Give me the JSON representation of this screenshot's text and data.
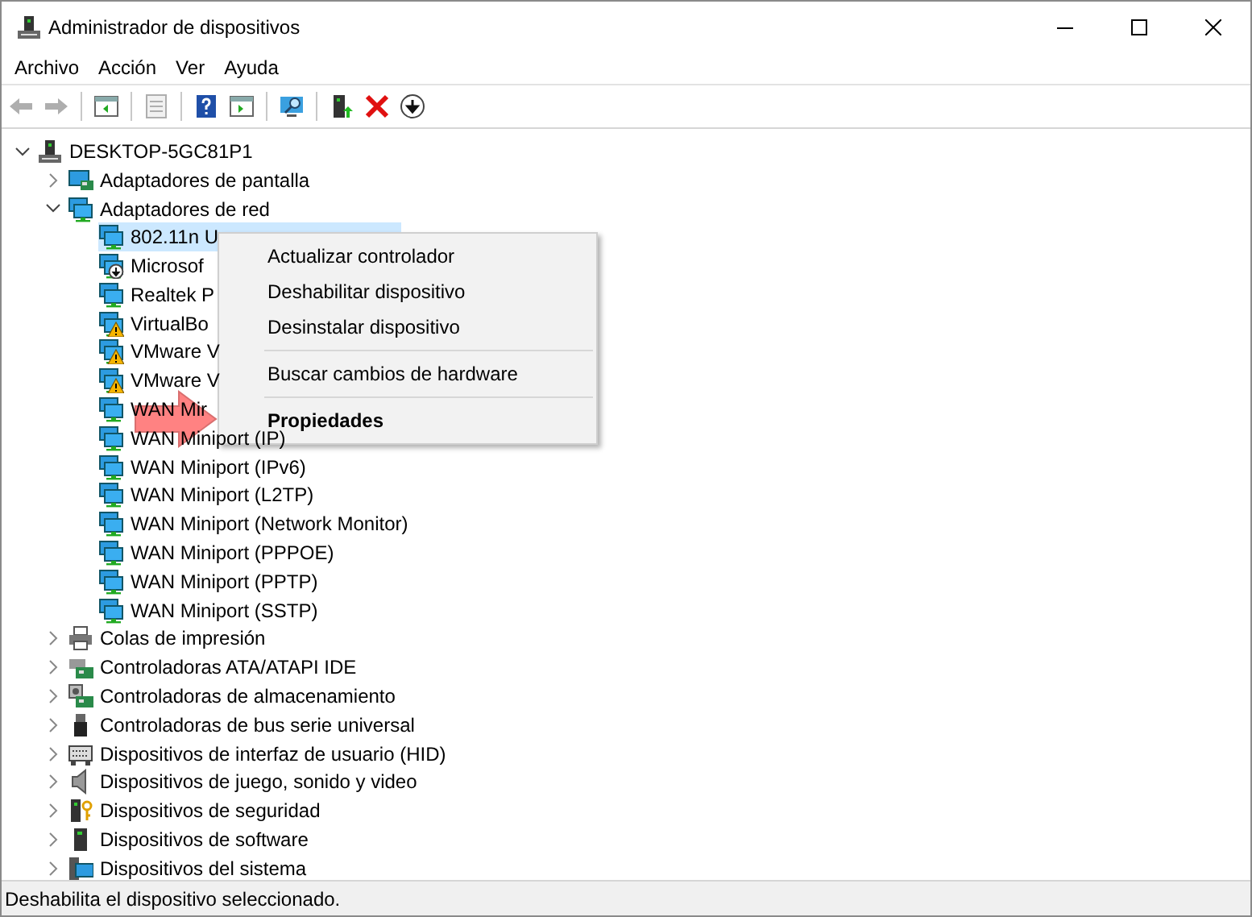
{
  "window": {
    "title": "Administrador de dispositivos"
  },
  "menu_bar": [
    "Archivo",
    "Acción",
    "Ver",
    "Ayuda"
  ],
  "toolbar": [
    {
      "disabled": true
    },
    {
      "disabled": true
    },
    {
      "disabled": false
    },
    {
      "disabled": true
    },
    {
      "disabled": false
    },
    {
      "disabled": false
    },
    {
      "disabled": false
    },
    {
      "disabled": false
    },
    {
      "disabled": false
    },
    {
      "disabled": false
    }
  ],
  "tree": [
    {
      "label": "DESKTOP-5GC81P1",
      "selected": false,
      "expanded": true,
      "children": [
        {
          "label": "Adaptadores de pantalla",
          "selected": false,
          "expanded": false
        },
        {
          "label": "Adaptadores de red",
          "selected": false,
          "expanded": true,
          "children": [
            {
              "label": "802.11n U",
              "selected": true,
              "disabled": false,
              "warning": false
            },
            {
              "label": "Microsof",
              "selected": false,
              "disabled": true,
              "warning": false
            },
            {
              "label": "Realtek P",
              "selected": false,
              "disabled": false,
              "warning": false
            },
            {
              "label": "VirtualBo",
              "selected": false,
              "disabled": false,
              "warning": true
            },
            {
              "label": "VMware V",
              "selected": false,
              "disabled": false,
              "warning": true
            },
            {
              "label": "VMware V",
              "selected": false,
              "disabled": false,
              "warning": true
            },
            {
              "label": "WAN Mir",
              "selected": false,
              "disabled": false,
              "warning": false
            },
            {
              "label": "WAN Miniport (IP)",
              "selected": false,
              "disabled": false,
              "warning": false
            },
            {
              "label": "WAN Miniport (IPv6)",
              "selected": false,
              "disabled": false,
              "warning": false
            },
            {
              "label": "WAN Miniport (L2TP)",
              "selected": false,
              "disabled": false,
              "warning": false
            },
            {
              "label": "WAN Miniport (Network Monitor)",
              "selected": false,
              "disabled": false,
              "warning": false
            },
            {
              "label": "WAN Miniport (PPPOE)",
              "selected": false,
              "disabled": false,
              "warning": false
            },
            {
              "label": "WAN Miniport (PPTP)",
              "selected": false,
              "disabled": false,
              "warning": false
            },
            {
              "label": "WAN Miniport (SSTP)",
              "selected": false,
              "disabled": false,
              "warning": false
            }
          ]
        },
        {
          "label": "Colas de impresión",
          "selected": false,
          "expanded": false
        },
        {
          "label": "Controladoras ATA/ATAPI IDE",
          "selected": false,
          "expanded": false
        },
        {
          "label": "Controladoras de almacenamiento",
          "selected": false,
          "expanded": false
        },
        {
          "label": "Controladoras de bus serie universal",
          "selected": false,
          "expanded": false
        },
        {
          "label": "Dispositivos de interfaz de usuario (HID)",
          "selected": false,
          "expanded": false
        },
        {
          "label": "Dispositivos de juego, sonido y video",
          "selected": false,
          "expanded": false
        },
        {
          "label": "Dispositivos de seguridad",
          "selected": false,
          "expanded": false
        },
        {
          "label": "Dispositivos de software",
          "selected": false,
          "expanded": false
        },
        {
          "label": "Dispositivos del sistema",
          "selected": false,
          "expanded": false
        }
      ]
    }
  ],
  "context_menu": [
    {
      "kind": "item",
      "label": "Actualizar controlador",
      "default": false
    },
    {
      "kind": "item",
      "label": "Deshabilitar dispositivo",
      "default": false
    },
    {
      "kind": "item",
      "label": "Desinstalar dispositivo",
      "default": false
    },
    {
      "kind": "separator"
    },
    {
      "kind": "item",
      "label": "Buscar cambios de hardware",
      "default": false
    },
    {
      "kind": "separator"
    },
    {
      "kind": "item",
      "label": "Propiedades",
      "default": true
    }
  ],
  "status_bar": "Deshabilita el dispositivo seleccionado."
}
